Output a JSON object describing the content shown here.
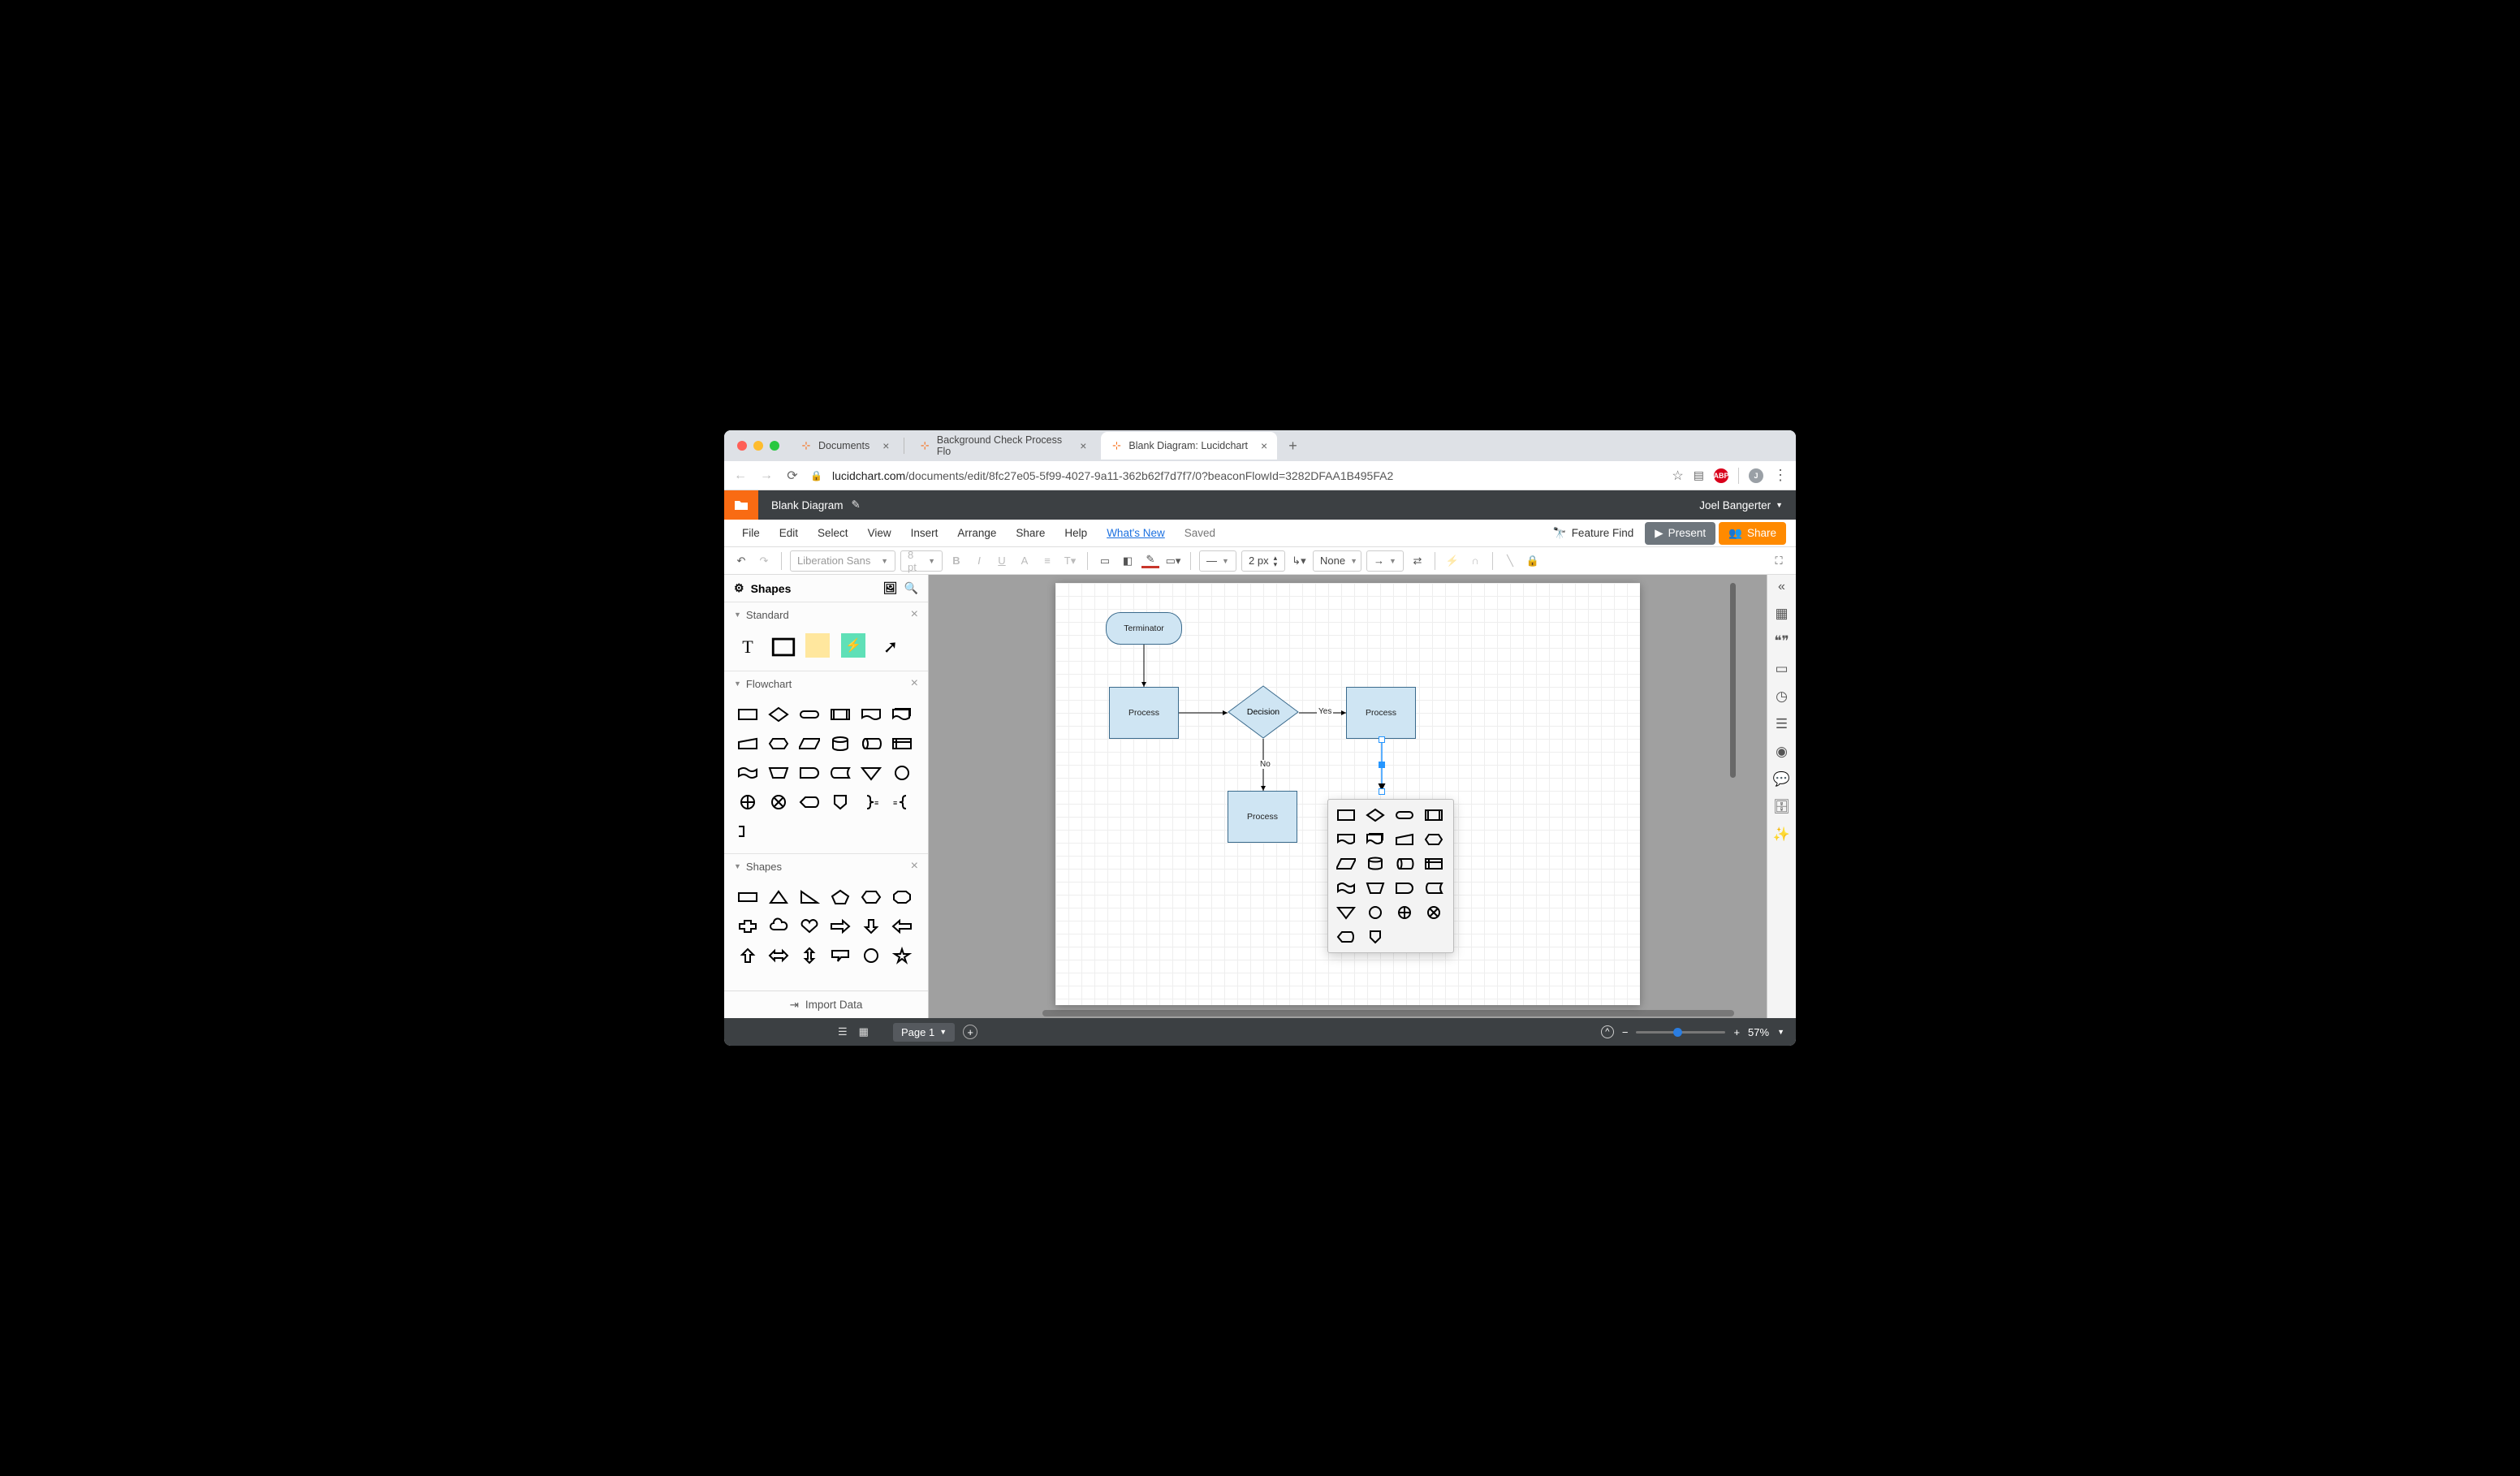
{
  "browser": {
    "tabs": [
      {
        "title": "Documents",
        "active": false
      },
      {
        "title": "Background Check Process Flo",
        "active": false
      },
      {
        "title": "Blank Diagram: Lucidchart",
        "active": true
      }
    ],
    "new_tab_glyph": "+",
    "url_domain": "lucidchart.com",
    "url_path": "/documents/edit/8fc27e05-5f99-4027-9a11-362b62f7d7f7/0?beaconFlowId=3282DFAA1B495FA2",
    "star_glyph": "☆",
    "ext_abp": "ABP",
    "avatar_initial": "J",
    "menu_glyph": "⋮"
  },
  "app_header": {
    "doc_title": "Blank Diagram",
    "edit_glyph": "✎",
    "user_name": "Joel Bangerter",
    "user_caret": "▼"
  },
  "menu": {
    "items": [
      "File",
      "Edit",
      "Select",
      "View",
      "Insert",
      "Arrange",
      "Share",
      "Help"
    ],
    "whats_new": "What's New",
    "saved": "Saved",
    "feature_find": "Feature Find",
    "present": "Present",
    "share": "Share"
  },
  "toolbar": {
    "font": "Liberation Sans",
    "font_size_placeholder": "8 pt",
    "stroke_width": "2 px",
    "fill_label": "None"
  },
  "left_panel": {
    "title": "Shapes",
    "sections": {
      "standard": "Standard",
      "flowchart": "Flowchart",
      "shapes": "Shapes"
    },
    "import": "Import Data"
  },
  "canvas": {
    "terminator": "Terminator",
    "process1": "Process",
    "decision": "Decision",
    "process_right": "Process",
    "process_bottom": "Process",
    "edge_yes": "Yes",
    "edge_no": "No"
  },
  "footer": {
    "page_label": "Page 1",
    "zoom_pct": "57%"
  }
}
